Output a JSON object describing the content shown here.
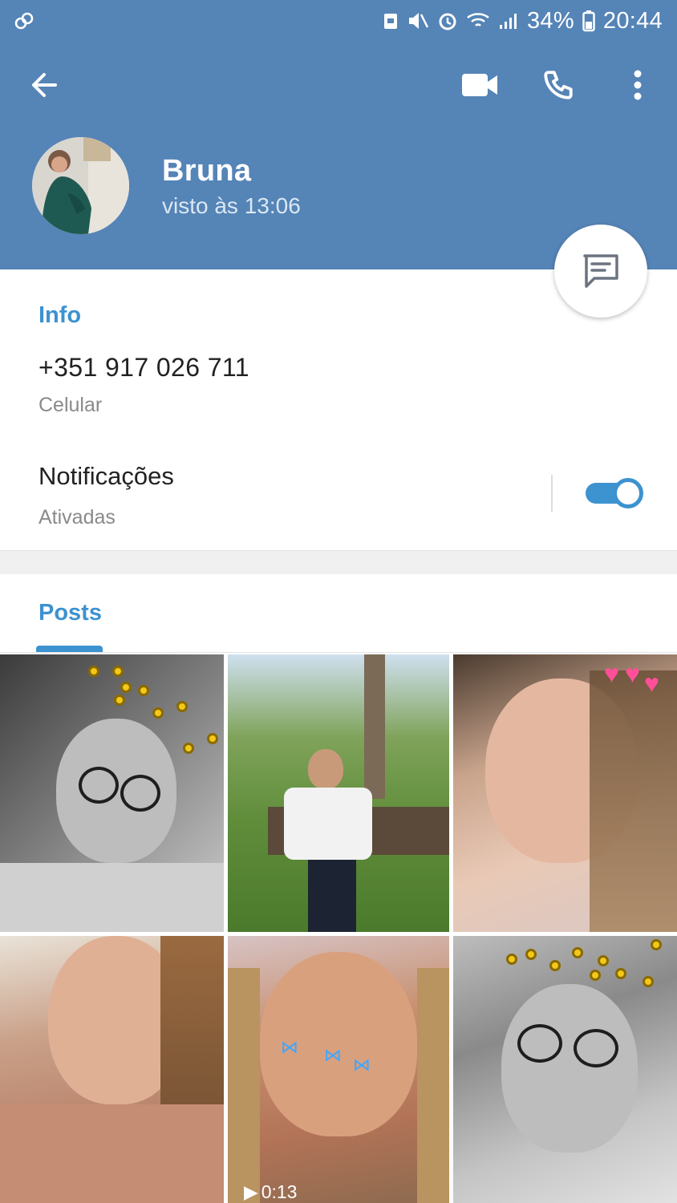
{
  "status_bar": {
    "battery_percent": "34%",
    "time": "20:44"
  },
  "profile": {
    "name": "Bruna",
    "last_seen": "visto às 13:06"
  },
  "info": {
    "section_title": "Info",
    "phone": "+351 917 026 711",
    "phone_label": "Celular",
    "notifications_title": "Notificações",
    "notifications_status": "Ativadas",
    "notifications_on": true
  },
  "posts": {
    "tab_label": "Posts",
    "items": [
      {
        "type": "photo"
      },
      {
        "type": "photo"
      },
      {
        "type": "photo"
      },
      {
        "type": "photo"
      },
      {
        "type": "video",
        "duration": "0:13"
      },
      {
        "type": "photo"
      }
    ]
  },
  "colors": {
    "header": "#5584b7",
    "accent": "#3d92d0"
  },
  "icons": {
    "back": "arrow-back-icon",
    "video": "video-camera-icon",
    "call": "phone-icon",
    "more": "more-vert-icon",
    "message": "message-icon"
  }
}
